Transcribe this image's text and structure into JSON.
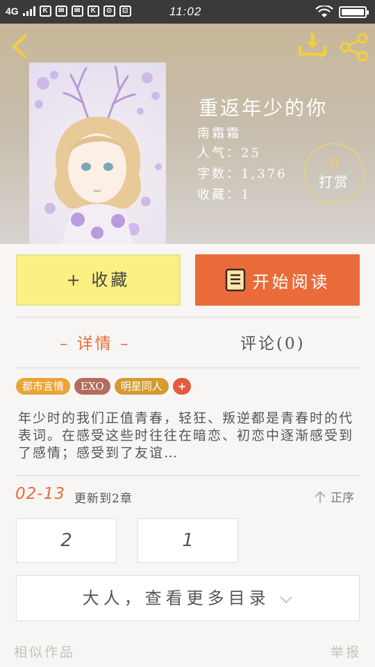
{
  "status_bar": {
    "network": "4G",
    "notification_icons": [
      "K",
      "✉",
      "✉",
      "K",
      "⊙",
      "⊡"
    ],
    "time": "11:02"
  },
  "header": {
    "icons": {
      "back": "back-arrow-icon",
      "download": "download-icon",
      "share": "share-icon"
    },
    "accent_color": "#f4cf3a"
  },
  "book": {
    "title": "重返年少的你",
    "author": "南霜霜",
    "popularity_label": "人气：",
    "popularity": "25",
    "wordcount_label": "字数：",
    "wordcount": "1,376",
    "favorites_label": "收藏：",
    "favorites": "1"
  },
  "reward": {
    "count": "0",
    "label": "打赏"
  },
  "actions": {
    "collect_label": "+ 收藏",
    "read_label": "开始阅读",
    "read_color": "#ea6b3a",
    "collect_color": "#fbf082"
  },
  "tabs": {
    "detail": "– 详情 –",
    "comments": "评论(0)"
  },
  "tags": [
    "都市言情",
    "EXO",
    "明星同人",
    "+"
  ],
  "description": "年少时的我们正值青春，轻狂、叛逆都是青春时的代表词。在感受这些时往往在暗恋、初恋中逐渐感受到了感情；感受到了友谊…",
  "update": {
    "date": "02-13",
    "text": "更新到2章",
    "order_label": "正序"
  },
  "chapters": [
    "2",
    "1"
  ],
  "more_catalog": "大人，查看更多目录",
  "footer": {
    "similar": "相似作品",
    "report": "举报"
  }
}
